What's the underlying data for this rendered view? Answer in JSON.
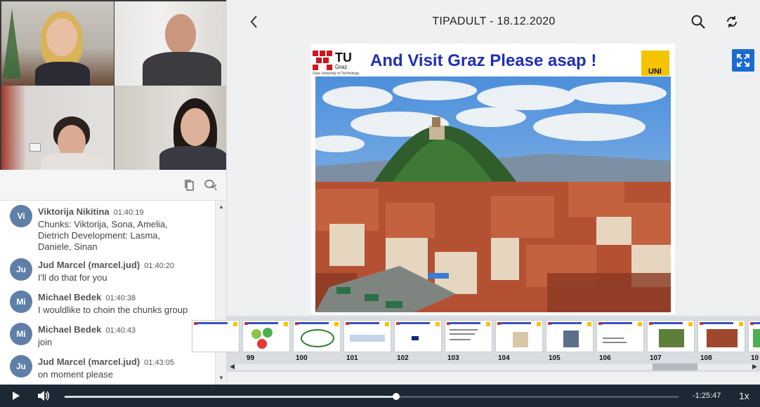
{
  "participants": [
    {
      "id": "p1"
    },
    {
      "id": "p2"
    },
    {
      "id": "p3"
    },
    {
      "id": "p4"
    }
  ],
  "chat_toolbar": {
    "icons": [
      "copy-icon",
      "chat-bubbles-icon"
    ]
  },
  "chat": {
    "messages": [
      {
        "initials": "Vi",
        "author": "Viktorija Nikitina",
        "time": "01:40:19",
        "lines": [
          "Chunks:  Viktorija, Sona, Amelia,",
          "Dietrich Development: Lasma,",
          "Daniele, Sinan"
        ]
      },
      {
        "initials": "Ju",
        "author": "Jud Marcel (marcel.jud)",
        "time": "01:40:20",
        "lines": [
          "I'll do that for you"
        ]
      },
      {
        "initials": "Mi",
        "author": "Michael Bedek",
        "time": "01:40:38",
        "lines": [
          "I wouldlike to choin the chunks group"
        ]
      },
      {
        "initials": "Mi",
        "author": "Michael Bedek",
        "time": "01:40:43",
        "lines": [
          "join"
        ]
      },
      {
        "initials": "Ju",
        "author": "Jud Marcel (marcel.jud)",
        "time": "01:43:05",
        "lines": [
          "on moment please"
        ]
      }
    ],
    "scroll_up": "▲",
    "scroll_down": "▼"
  },
  "stage": {
    "title": "TIPADULT - 18.12.2020",
    "back_icon": "chevron-left-icon",
    "search_icon": "search-icon",
    "rotate_icon": "rotate-icon",
    "fullscreen_icon": "fullscreen-icon"
  },
  "slide": {
    "heading": "And Visit Graz Please asap !",
    "logo_text": "TU",
    "logo_sub": "Graz",
    "logo_caption": "Graz University of Technology",
    "uni_text": "UNI"
  },
  "thumbnails": [
    {
      "num": "99"
    },
    {
      "num": "100"
    },
    {
      "num": "101"
    },
    {
      "num": "102"
    },
    {
      "num": "103"
    },
    {
      "num": "104"
    },
    {
      "num": "105"
    },
    {
      "num": "106"
    },
    {
      "num": "107"
    },
    {
      "num": "108"
    },
    {
      "num": "10"
    }
  ],
  "player": {
    "progress": 0.54,
    "time_remaining": "-1:25:47",
    "speed": "1x",
    "colors": {
      "bar": "#1c2834",
      "accent": "#1c6bd1"
    }
  }
}
